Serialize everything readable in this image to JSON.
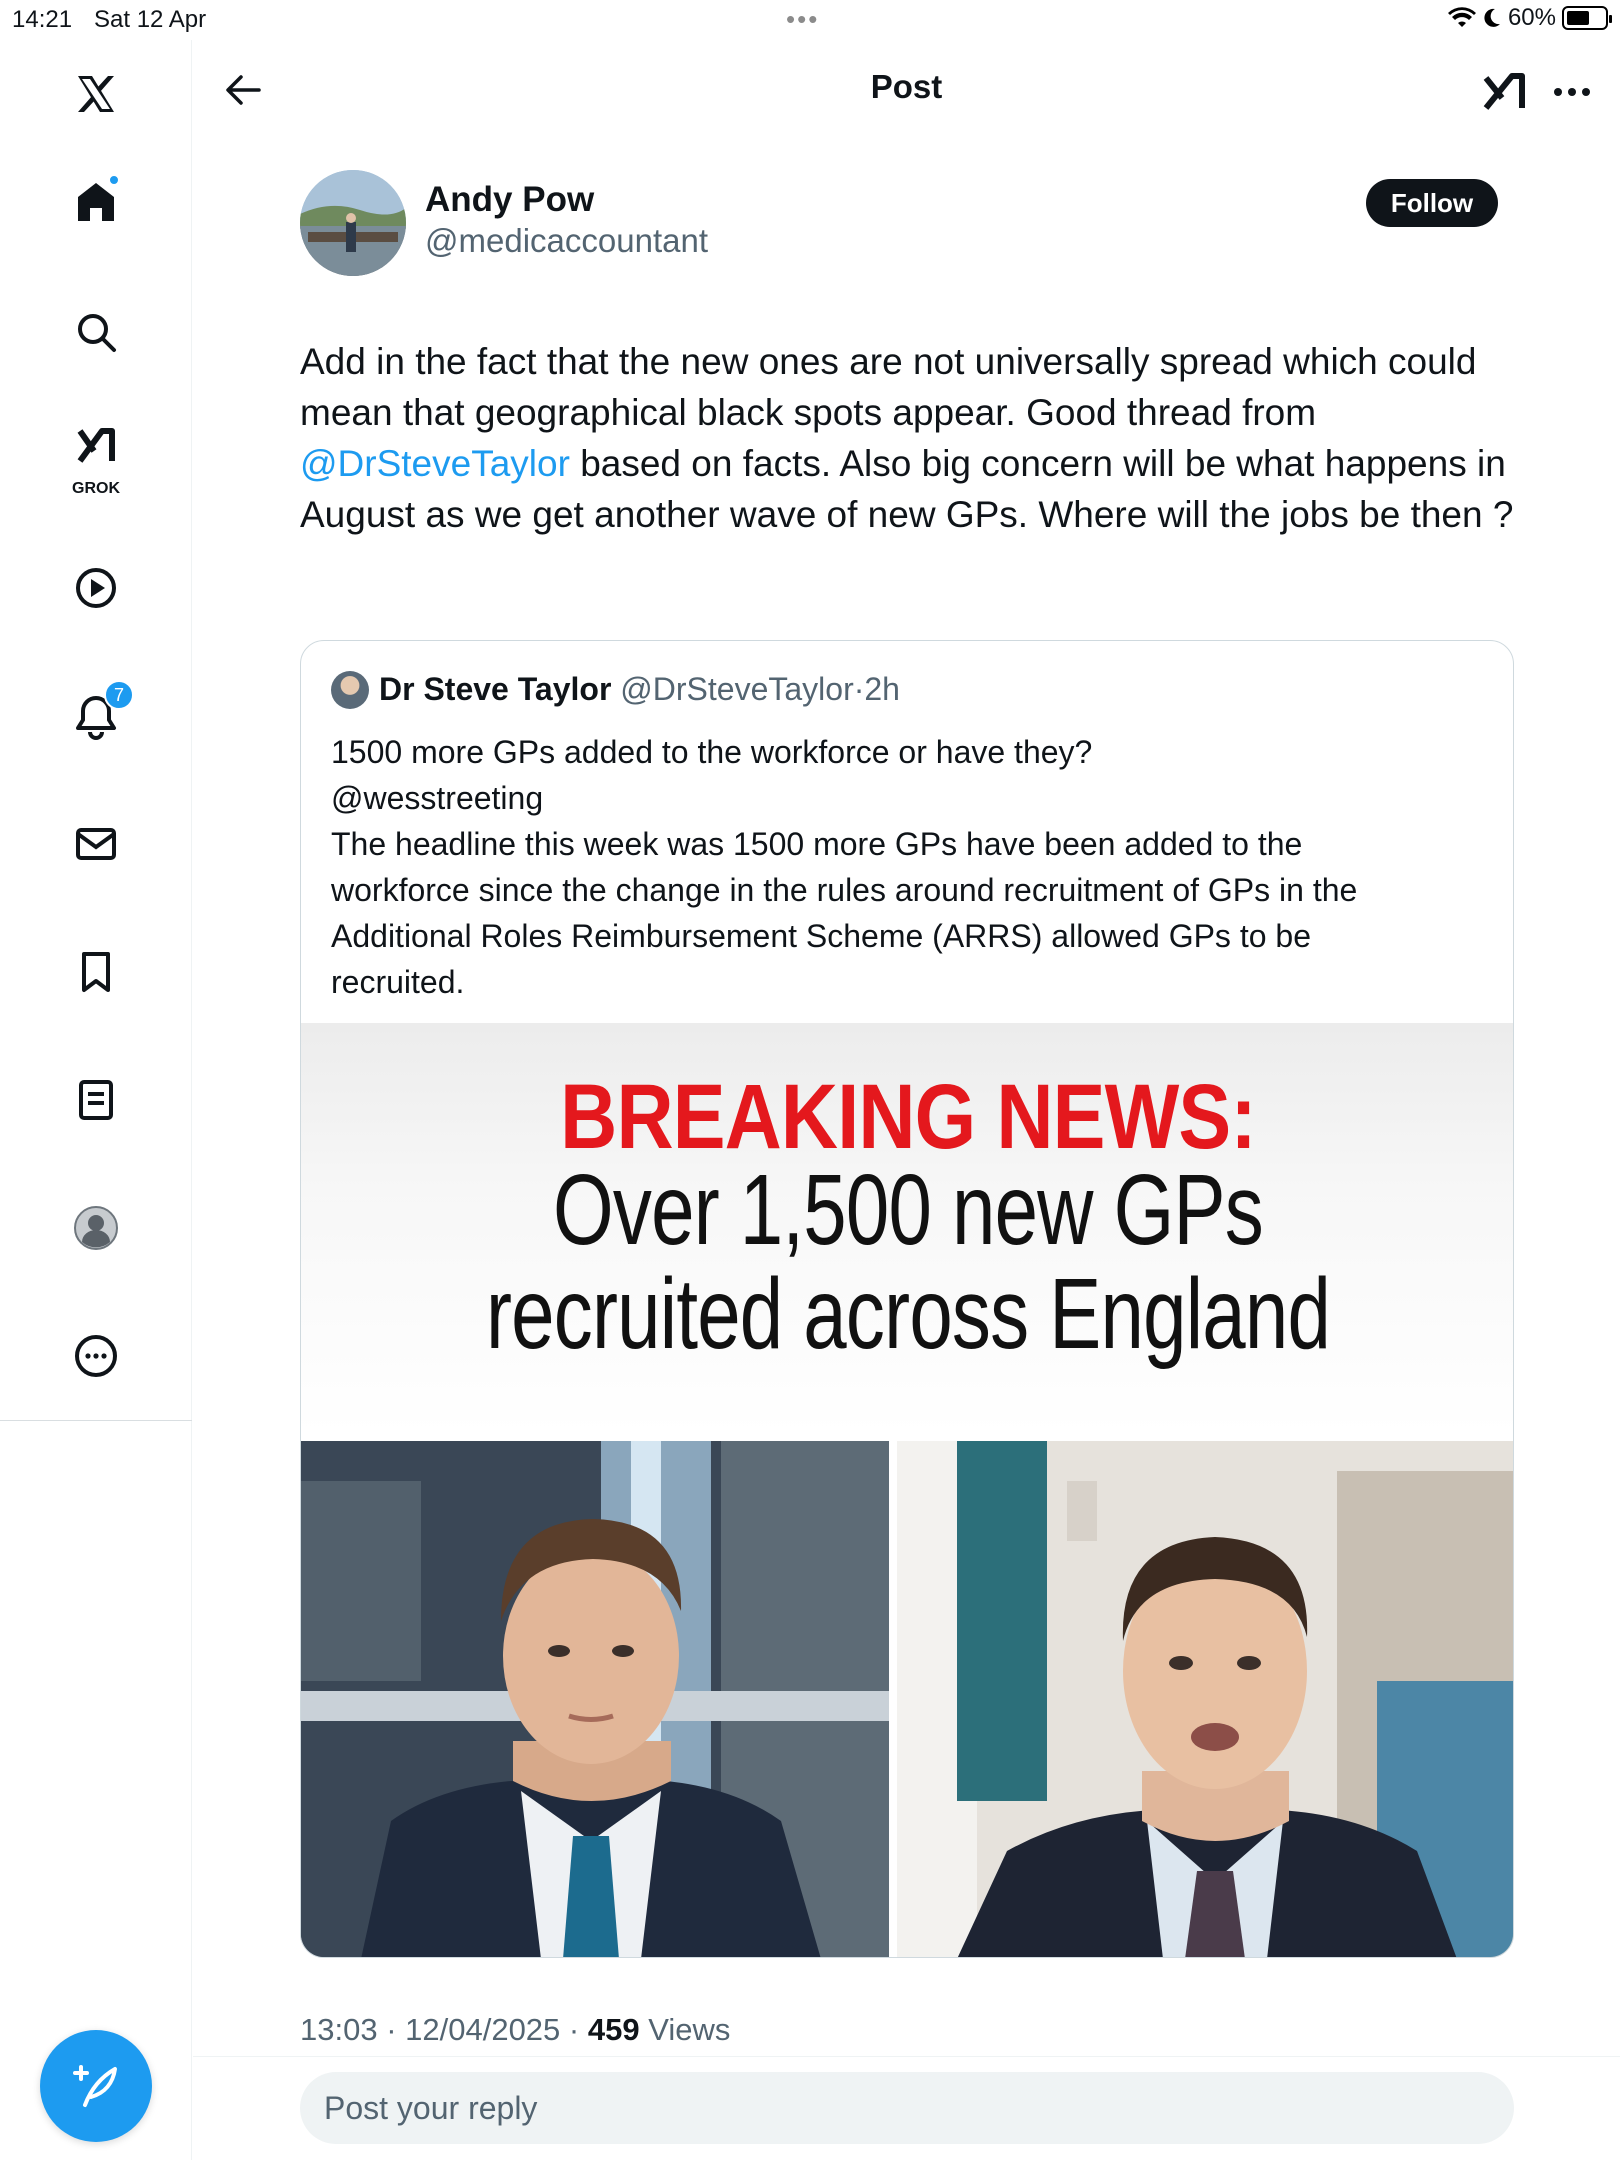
{
  "status_bar": {
    "time": "14:21",
    "date": "Sat 12 Apr",
    "battery": "60%",
    "battery_fraction": 0.6
  },
  "sidebar": {
    "items": [
      {
        "icon": "x-logo-icon"
      },
      {
        "icon": "home-icon"
      },
      {
        "icon": "search-icon"
      },
      {
        "icon": "grok-icon",
        "label": "GROK"
      },
      {
        "icon": "video-icon"
      },
      {
        "icon": "notifications-icon",
        "badge": "7"
      },
      {
        "icon": "messages-icon"
      },
      {
        "icon": "bookmarks-icon"
      },
      {
        "icon": "lists-icon"
      },
      {
        "icon": "profile-icon"
      },
      {
        "icon": "more-icon"
      }
    ],
    "compose_icon": "compose-post-icon"
  },
  "header": {
    "title": "Post"
  },
  "post": {
    "author_name": "Andy Pow",
    "author_handle": "@medicaccountant",
    "follow_label": "Follow",
    "text_before_mention": "Add in the fact that the new ones are not universally spread which could mean that geographical black spots appear. Good thread from ",
    "mention": "@DrSteveTaylor",
    "text_after_mention": " based on facts. Also big concern will be what happens in August as we get another wave of new GPs. Where will the jobs be then ?",
    "time": "13:03",
    "date": "12/04/2025",
    "views_count": "459",
    "views_label": "Views"
  },
  "quote": {
    "author_name": "Dr Steve Taylor",
    "author_handle": "@DrSteveTaylor",
    "separator": "·",
    "age": "2h",
    "lines": [
      "1500 more GPs added to the workforce or have they?",
      "@wesstreeting",
      "The headline this week was 1500 more GPs have been added to the",
      "workforce since the change in the rules around recruitment of GPs in the",
      "Additional Roles Reimbursement Scheme (ARRS) allowed GPs to be",
      "recruited."
    ],
    "image": {
      "breaking": "BREAKING NEWS:",
      "headline_line1": "Over 1,500 new GPs",
      "headline_line2": "recruited across England"
    }
  },
  "reply": {
    "placeholder": "Post your reply"
  },
  "colors": {
    "accent": "#1d9bf0",
    "breaking_red": "#e4181d",
    "text": "#0f1419",
    "secondary_text": "#536471"
  }
}
